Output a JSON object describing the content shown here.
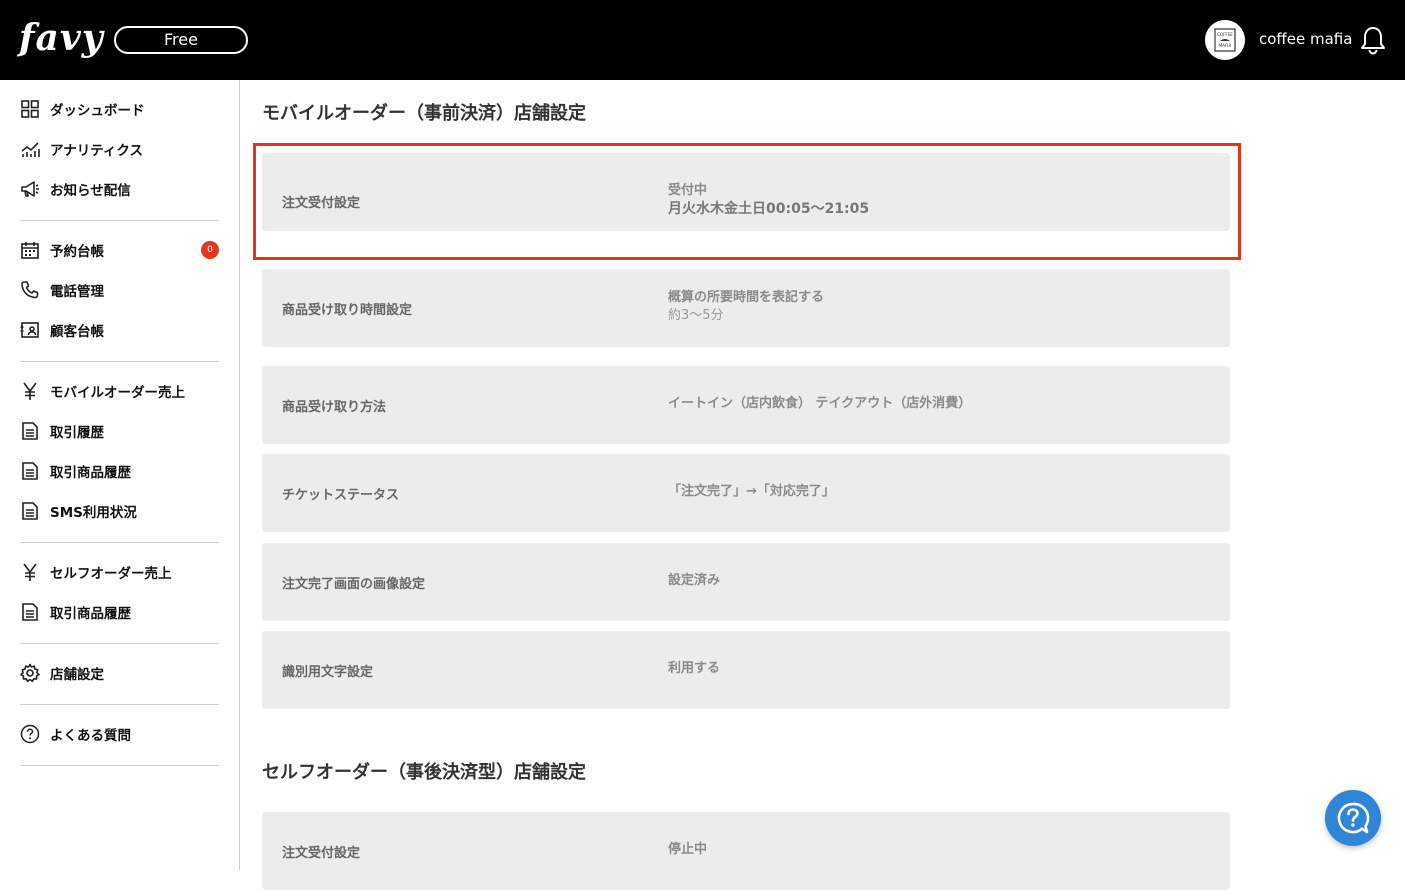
{
  "header": {
    "logo": "favy",
    "plan": "Free",
    "user_name": "coffee mafia",
    "avatar_text_top": "COFFEE",
    "avatar_text_bottom": "MAFIA"
  },
  "sidebar": {
    "groups": [
      [
        {
          "label": "ダッシュボード",
          "icon": "grid-icon"
        },
        {
          "label": "アナリティクス",
          "icon": "chart-icon"
        },
        {
          "label": "お知らせ配信",
          "icon": "megaphone-icon"
        }
      ],
      [
        {
          "label": "予約台帳",
          "icon": "calendar-icon",
          "badge": "0"
        },
        {
          "label": "電話管理",
          "icon": "phone-icon"
        },
        {
          "label": "顧客台帳",
          "icon": "contact-card-icon"
        }
      ],
      [
        {
          "label": "モバイルオーダー売上",
          "icon": "yen-icon"
        },
        {
          "label": "取引履歴",
          "icon": "document-icon"
        },
        {
          "label": "取引商品履歴",
          "icon": "document-icon"
        },
        {
          "label": "SMS利用状況",
          "icon": "document-icon"
        }
      ],
      [
        {
          "label": "セルフオーダー売上",
          "icon": "yen-icon"
        },
        {
          "label": "取引商品履歴",
          "icon": "document-icon"
        }
      ],
      [
        {
          "label": "店舗設定",
          "icon": "gear-icon"
        }
      ],
      [
        {
          "label": "よくある質問",
          "icon": "question-icon"
        }
      ]
    ]
  },
  "main": {
    "mobile_section": {
      "title": "モバイルオーダー（事前決済）店舗設定",
      "rows": [
        {
          "label": "注文受付設定",
          "value1": "受付中",
          "value2": "月火水木金土日00:05〜21:05"
        },
        {
          "label": "商品受け取り時間設定",
          "value1": "概算の所要時間を表記する",
          "value2": "約3〜5分"
        },
        {
          "label": "商品受け取り方法",
          "value1": "イートイン（店内飲食） テイクアウト（店外消費）"
        },
        {
          "label": "チケットステータス",
          "value1": "「注文完了」→「対応完了」"
        },
        {
          "label": "注文完了画面の画像設定",
          "value1": "設定済み"
        },
        {
          "label": "識別用文字設定",
          "value1": "利用する"
        }
      ]
    },
    "self_section": {
      "title": "セルフオーダー（事後決済型）店舗設定",
      "rows": [
        {
          "label": "注文受付設定",
          "value1": "停止中"
        }
      ]
    }
  },
  "colors": {
    "header_bg": "#000000",
    "card_bg": "#ececec",
    "highlight": "#e8331c",
    "badge": "#e3371e",
    "help_button": "#2f86d6"
  }
}
